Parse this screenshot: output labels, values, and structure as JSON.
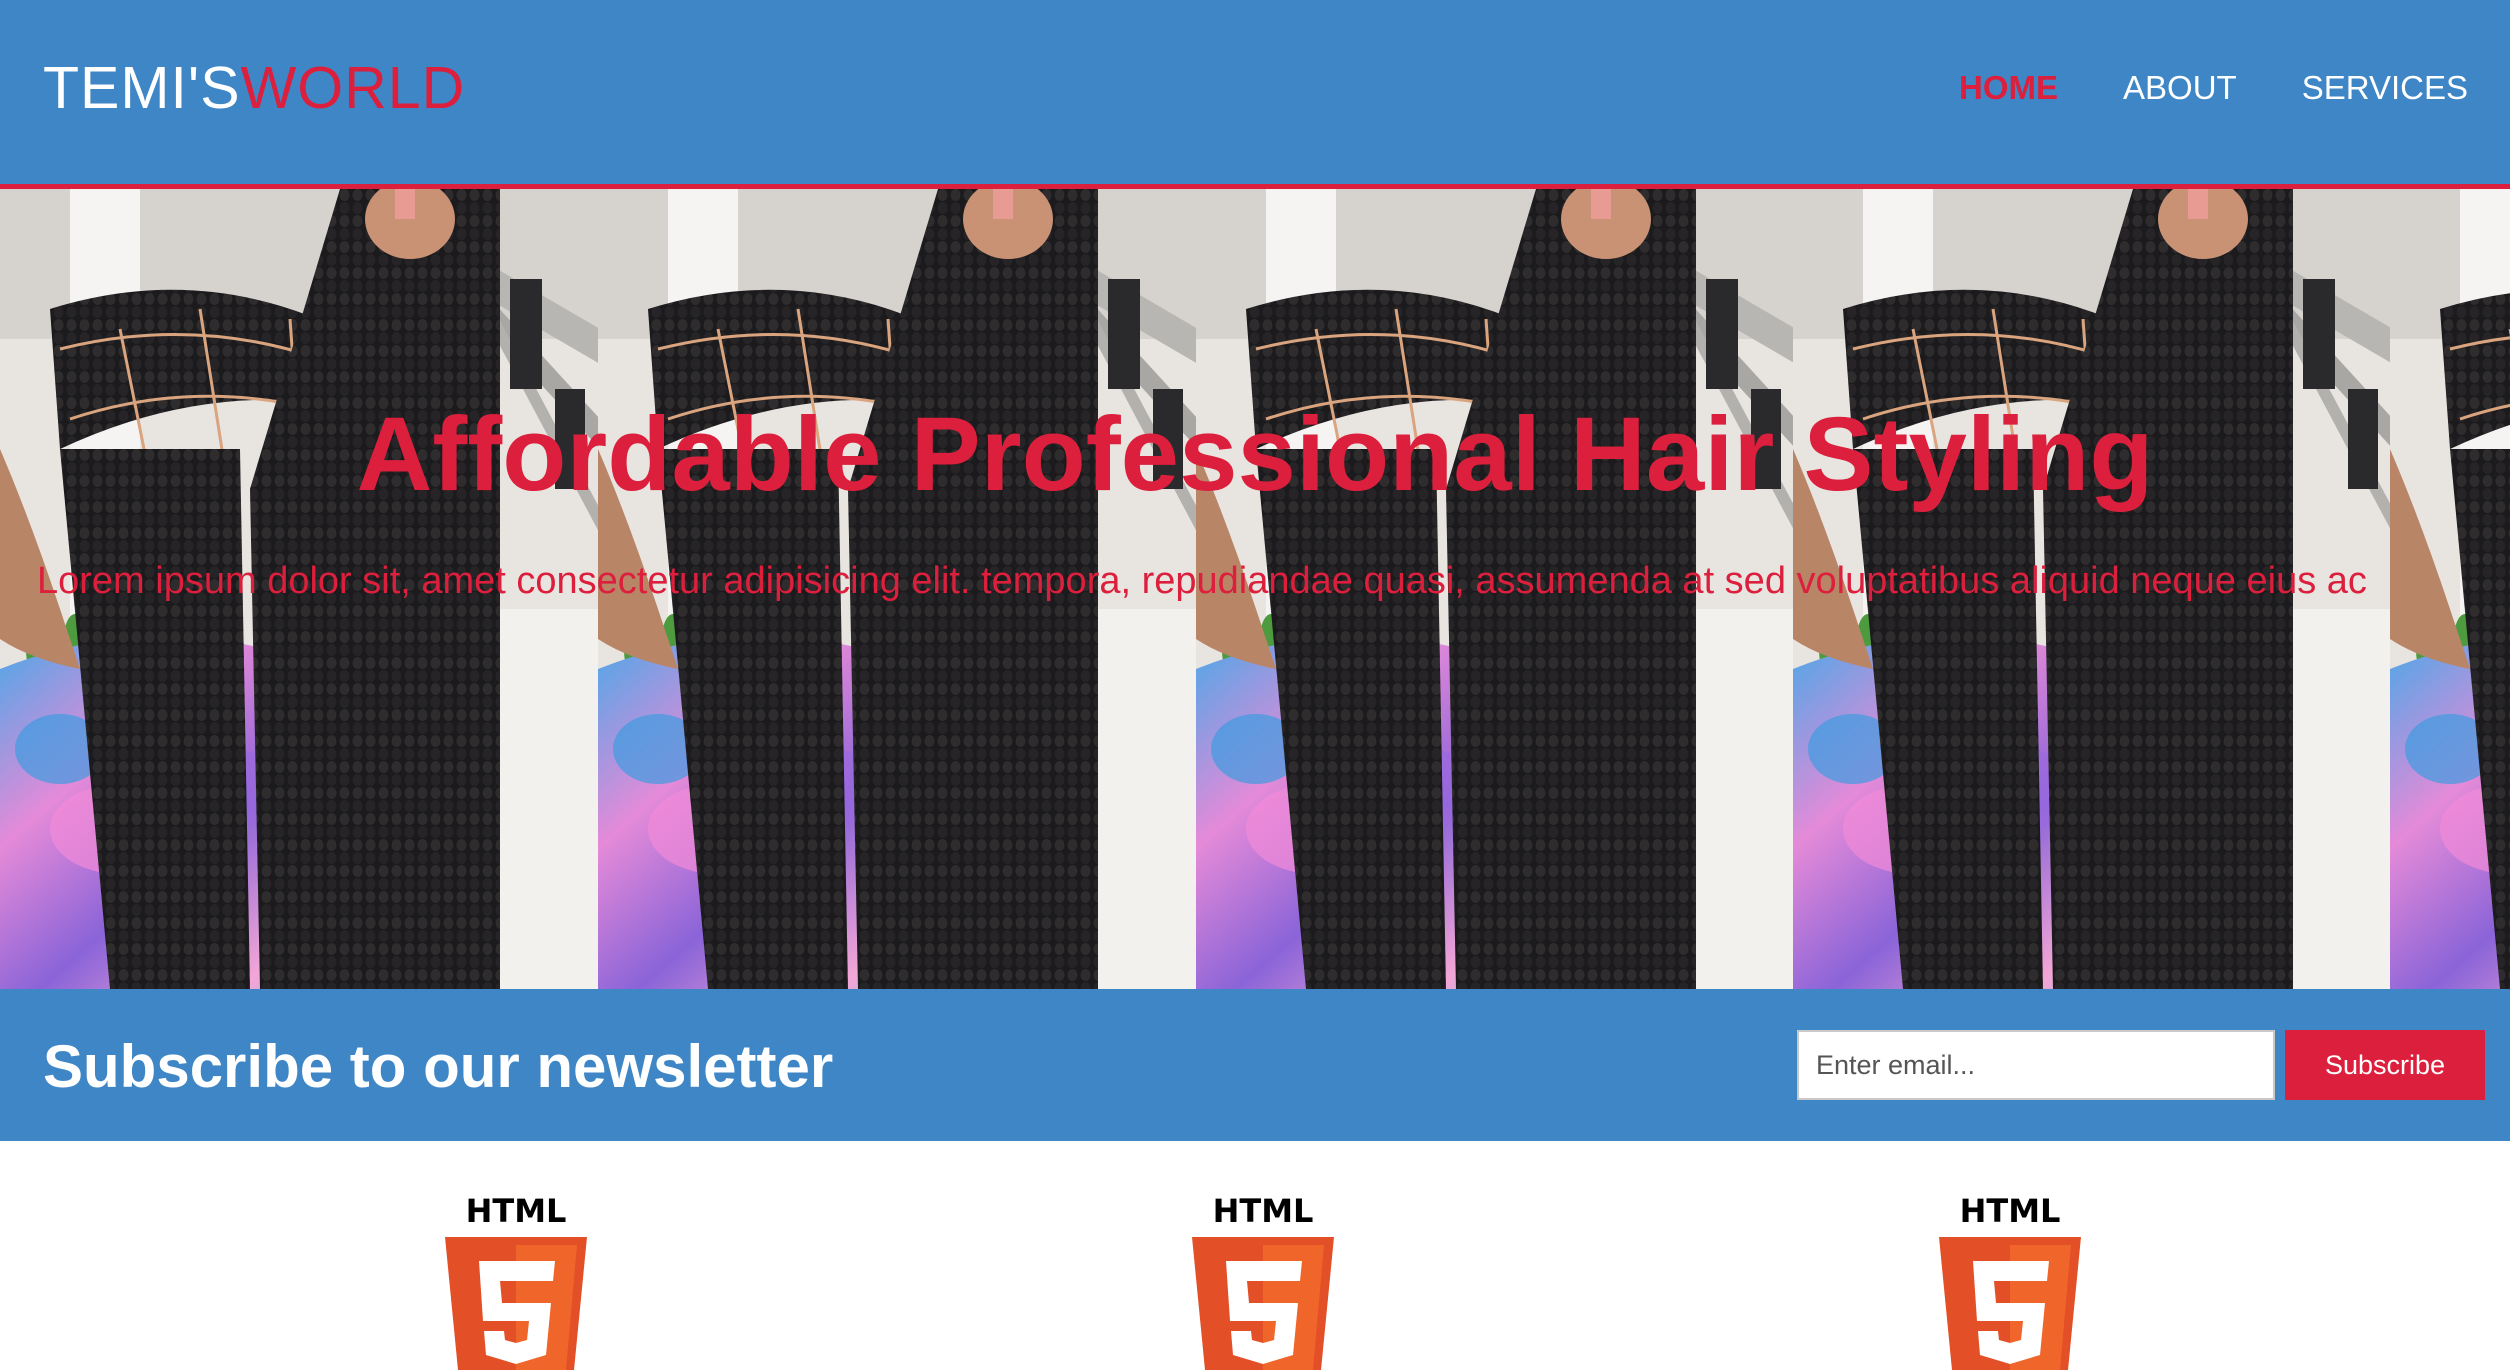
{
  "header": {
    "logo": {
      "part_a": "TEMI'S",
      "part_b": "WORLD"
    },
    "nav": [
      {
        "label": "HOME",
        "active": true
      },
      {
        "label": "ABOUT",
        "active": false
      },
      {
        "label": "SERVICES",
        "active": false
      }
    ]
  },
  "hero": {
    "title": "Affordable Professional Hair Styling",
    "text": "Lorem ipsum dolor sit, amet consectetur adipisicing elit. tempora, repudiandae quasi, assumenda at sed voluptatibus aliquid neque eius ac",
    "background_image": "braided-hair-photo"
  },
  "newsletter": {
    "title": "Subscribe to our newsletter",
    "email_placeholder": "Enter email...",
    "button_label": "Subscribe"
  },
  "features": [
    {
      "icon": "html5-logo-icon",
      "label": "HTML"
    },
    {
      "icon": "html5-logo-icon",
      "label": "HTML"
    },
    {
      "icon": "html5-logo-icon",
      "label": "HTML"
    }
  ],
  "colors": {
    "brand_blue": "#3f86c6",
    "accent_red": "#dc1f3c",
    "html5_orange": "#e34f26"
  }
}
